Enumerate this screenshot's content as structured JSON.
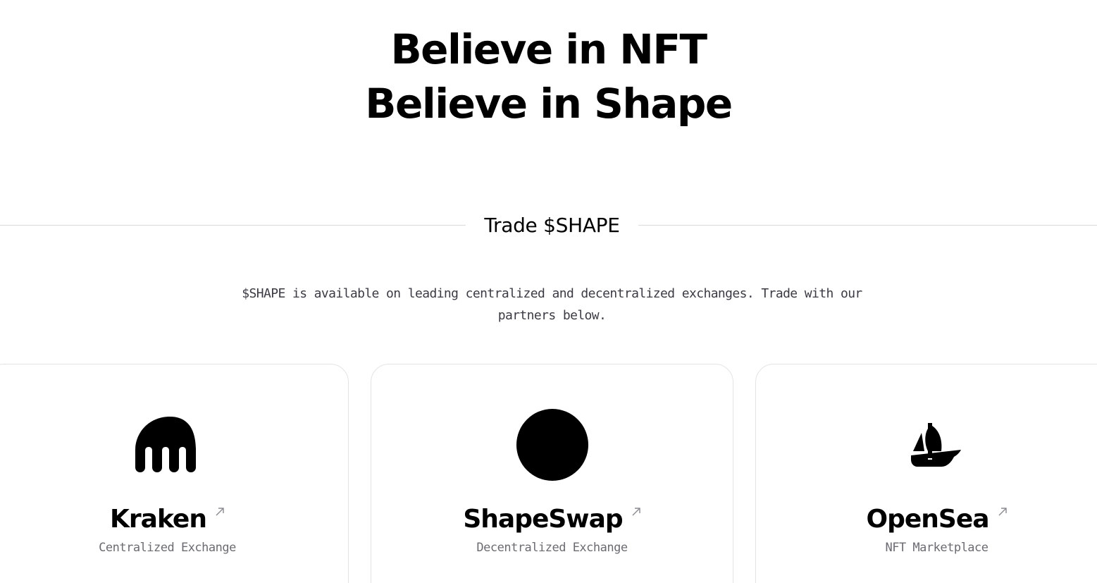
{
  "hero": {
    "line1": "Believe in NFT",
    "line2": "Believe in Shape"
  },
  "trade": {
    "title": "Trade $SHAPE",
    "description": "$SHAPE is available on leading centralized and decentralized exchanges. Trade with our partners below."
  },
  "partners": [
    {
      "name": "Kraken",
      "type": "Centralized Exchange",
      "icon": "kraken-logo-icon"
    },
    {
      "name": "ShapeSwap",
      "type": "Decentralized Exchange",
      "icon": "shapeswap-logo-icon"
    },
    {
      "name": "OpenSea",
      "type": "NFT Marketplace",
      "icon": "opensea-logo-icon"
    }
  ],
  "colors": {
    "text": "#000000",
    "muted_text": "#6b6b72",
    "body_text": "#3b3b44",
    "border": "#e4e4e7",
    "divider": "#d9d9d9",
    "background": "#ffffff"
  }
}
